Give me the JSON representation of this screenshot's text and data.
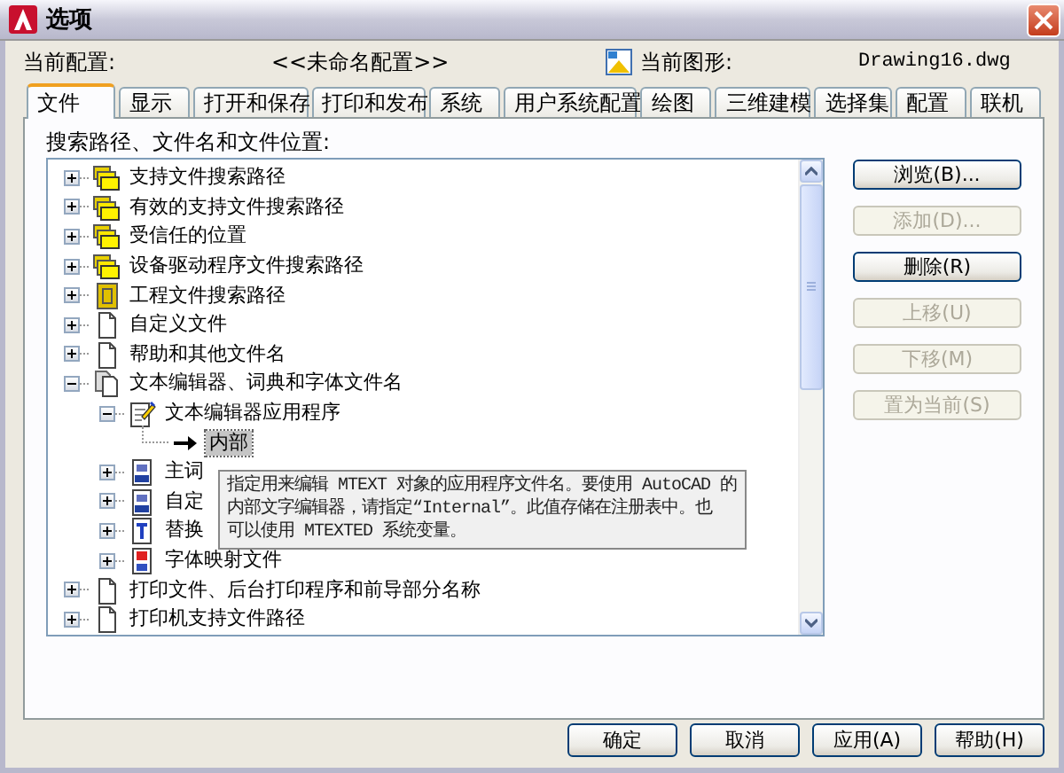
{
  "window": {
    "title": "选项"
  },
  "profile": {
    "label": "当前配置:",
    "value": "<<未命名配置>>"
  },
  "drawing": {
    "label": "当前图形:",
    "value": "Drawing16.dwg"
  },
  "tabs": [
    {
      "label": "文件",
      "selected": true
    },
    {
      "label": "显示",
      "selected": false
    },
    {
      "label": "打开和保存",
      "selected": false
    },
    {
      "label": "打印和发布",
      "selected": false
    },
    {
      "label": "系统",
      "selected": false
    },
    {
      "label": "用户系统配置",
      "selected": false
    },
    {
      "label": "绘图",
      "selected": false
    },
    {
      "label": "三维建模",
      "selected": false
    },
    {
      "label": "选择集",
      "selected": false
    },
    {
      "label": "配置",
      "selected": false
    },
    {
      "label": "联机",
      "selected": false
    }
  ],
  "panel_label": "搜索路径、文件名和文件位置:",
  "tree": [
    {
      "label": "支持文件搜索路径",
      "kind": "folders",
      "expanded": false
    },
    {
      "label": "有效的支持文件搜索路径",
      "kind": "folders",
      "expanded": false
    },
    {
      "label": "受信任的位置",
      "kind": "folders",
      "expanded": false
    },
    {
      "label": "设备驱动程序文件搜索路径",
      "kind": "folders",
      "expanded": false
    },
    {
      "label": "工程文件搜索路径",
      "kind": "project",
      "expanded": false
    },
    {
      "label": "自定义文件",
      "kind": "file",
      "expanded": false
    },
    {
      "label": "帮助和其他文件名",
      "kind": "file",
      "expanded": false
    },
    {
      "label": "文本编辑器、词典和字体文件名",
      "kind": "files",
      "expanded": true,
      "children": [
        {
          "label": "文本编辑器应用程序",
          "kind": "editor",
          "expanded": true,
          "children": [
            {
              "label": "内部",
              "kind": "value",
              "selected": true
            }
          ]
        },
        {
          "label": "主词",
          "kind": "dictionary",
          "expanded": false
        },
        {
          "label": "自定",
          "kind": "dictionary",
          "expanded": false
        },
        {
          "label": "替换",
          "kind": "replace",
          "expanded": false
        },
        {
          "label": "字体映射文件",
          "kind": "font-map",
          "expanded": false
        }
      ]
    },
    {
      "label": "打印文件、后台打印程序和前导部分名称",
      "kind": "file",
      "expanded": false
    },
    {
      "label": "打印机支持文件路径",
      "kind": "file",
      "expanded": false
    }
  ],
  "tooltip": {
    "lines": [
      "指定用来编辑 MTEXT 对象的应用程序文件名。要使用 AutoCAD 的",
      "内部文字编辑器，请指定“Internal”。此值存储在注册表中。也",
      "可以使用 MTEXTED 系统变量。"
    ]
  },
  "side_buttons": [
    {
      "label": "浏览(B)...",
      "disabled": false
    },
    {
      "label": "添加(D)...",
      "disabled": true
    },
    {
      "label": "删除(R)",
      "disabled": false
    },
    {
      "label": "上移(U)",
      "disabled": true
    },
    {
      "label": "下移(M)",
      "disabled": true
    },
    {
      "label": "置为当前(S)",
      "disabled": true
    }
  ],
  "buttons": [
    {
      "label": "确定"
    },
    {
      "label": "取消"
    },
    {
      "label": "应用(A)"
    },
    {
      "label": "帮助(H)"
    }
  ]
}
